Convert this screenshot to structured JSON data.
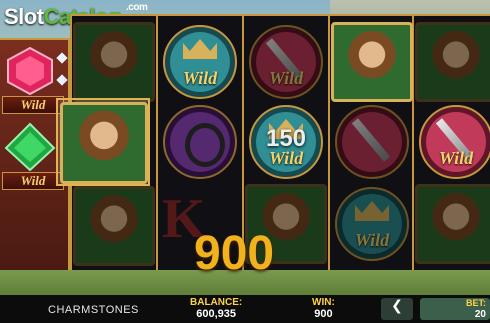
{
  "watermark": {
    "part1": "Slot",
    "part2": "Catalog",
    "suffix": ".com"
  },
  "left_panel": {
    "wild_label_1": "Wild",
    "wild_label_2": "Wild"
  },
  "reels": {
    "wild_label": "Wild",
    "multiplier": "150",
    "letter_symbol": "K"
  },
  "win_display": "900",
  "bottom_bar": {
    "game_name": "CHARMSTONES",
    "balance_label": "BALANCE:",
    "balance_value": "600,935",
    "win_label": "WIN:",
    "win_value": "900",
    "prev_button": "❮",
    "bet_label": "BET:",
    "bet_value": "20"
  },
  "colors": {
    "gold": "#c7973d",
    "win": "#f2b21e",
    "accent_green": "#5fb83a"
  }
}
